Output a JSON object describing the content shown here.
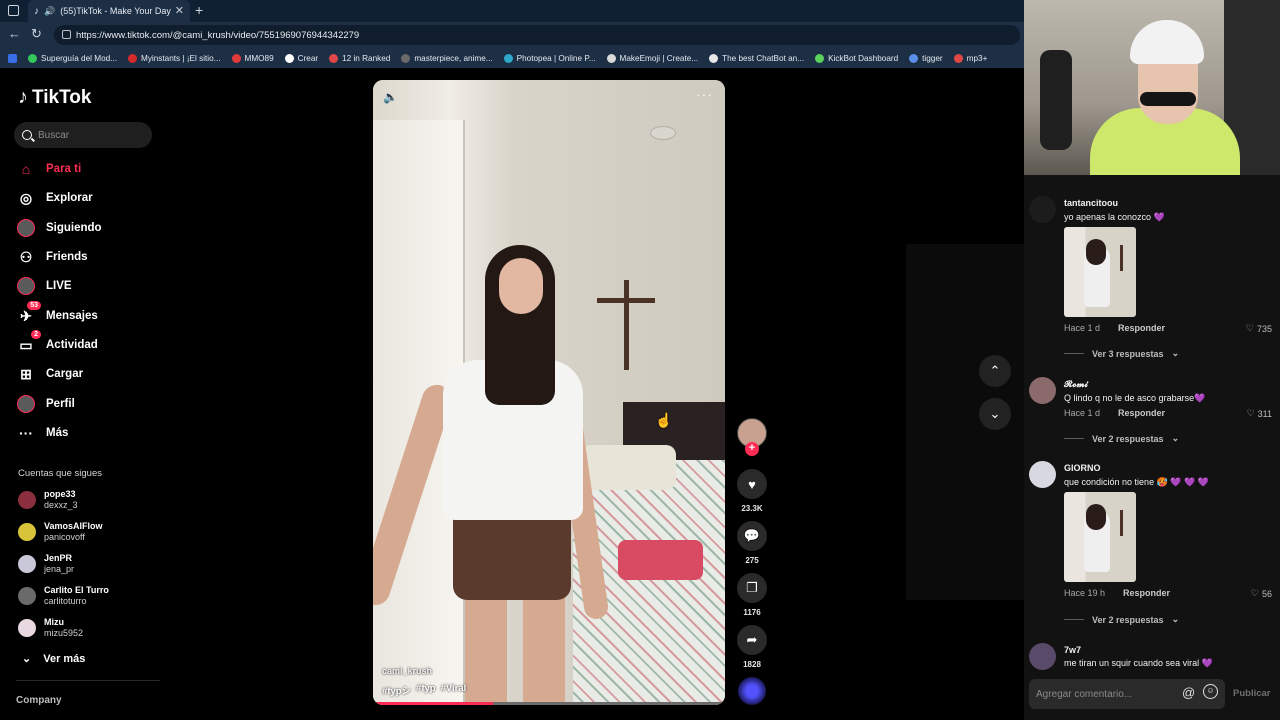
{
  "browser": {
    "tab_title": "(55)TikTok - Make Your Day",
    "url": "https://www.tiktok.com/@cami_krush/video/7551969076944342279",
    "bookmarks": [
      "Superguía del Mod...",
      "Myinstants | ¡El sitio...",
      "MMO89",
      "Crear",
      "12 in Ranked",
      "masterpiece, anime...",
      "Photopea | Online P...",
      "MakeEmoji | Create...",
      "The best ChatBot an...",
      "KickBot Dashboard",
      "tigger",
      "mp3+"
    ],
    "bookmark_colors": [
      "#34c759",
      "#d62b2b",
      "#e03a3a",
      "#ffffff",
      "#e04848",
      "#6a6a6a",
      "#2ea7c9",
      "#d9d9d9",
      "#e8e8e8",
      "#5ad15a",
      "#5a8ee8",
      "#e04848"
    ]
  },
  "sidebar": {
    "brand": "TikTok",
    "search_placeholder": "Buscar",
    "nav": [
      {
        "label": "Para ti",
        "icon": "home-icon"
      },
      {
        "label": "Explorar",
        "icon": "compass-icon"
      },
      {
        "label": "Siguiendo",
        "icon": "following-icon"
      },
      {
        "label": "Friends",
        "icon": "friends-icon"
      },
      {
        "label": "LIVE",
        "icon": "live-icon"
      },
      {
        "label": "Mensajes",
        "icon": "messages-icon",
        "badge": "53"
      },
      {
        "label": "Actividad",
        "icon": "activity-icon",
        "badge": "2"
      },
      {
        "label": "Cargar",
        "icon": "upload-icon"
      },
      {
        "label": "Perfil",
        "icon": "profile-icon"
      },
      {
        "label": "Más",
        "icon": "more-icon"
      }
    ],
    "following_title": "Cuentas que sigues",
    "following": [
      {
        "name": "pope33",
        "handle": "dexxz_3",
        "color": "#8b2f3e"
      },
      {
        "name": "VamosAlFlow",
        "handle": "panicovoff",
        "color": "#d8c43a"
      },
      {
        "name": "JenPR",
        "handle": "jena_pr",
        "color": "#c8c8d8"
      },
      {
        "name": "Carlito El Turro",
        "handle": "carlitoturro",
        "color": "#6a6a6a"
      },
      {
        "name": "Mizu",
        "handle": "mizu5952",
        "color": "#e8d8e0"
      }
    ],
    "see_more": "Ver más",
    "company": "Company"
  },
  "video": {
    "author": "cami_krush",
    "hashtags": [
      "#fypシ",
      "#fyp",
      "#Viral"
    ],
    "progress": 0.34,
    "likes": "23.3K",
    "comments": "275",
    "saves": "1176",
    "shares": "1828"
  },
  "comments": [
    {
      "user": "tantancitoou",
      "text": "yo apenas la conozco 💜",
      "time": "Hace 1 d",
      "reply": "Responder",
      "likes": "735",
      "replies": "Ver 3 respuestas",
      "has_image": true
    },
    {
      "user": "𝓡𝓸𝓶𝓲",
      "text": "Q lindo q no le de asco grabarse💜",
      "time": "Hace 1 d",
      "reply": "Responder",
      "likes": "311",
      "replies": "Ver 2 respuestas",
      "has_image": false
    },
    {
      "user": "GIORNO",
      "text": "que condición no tiene 🥵 💜 💜 💜",
      "time": "Hace 19 h",
      "reply": "Responder",
      "likes": "56",
      "replies": "Ver 2 respuestas",
      "has_image": true
    },
    {
      "user": "7w7",
      "text": "me tiran un squir cuando sea viral 💜",
      "time": "",
      "reply": "",
      "likes": "",
      "replies": "",
      "has_image": false
    }
  ],
  "comment_input": {
    "placeholder": "Agregar comentario...",
    "publish": "Publicar"
  },
  "colors": {
    "accent": "#fe2c55",
    "panel": "#121212"
  }
}
